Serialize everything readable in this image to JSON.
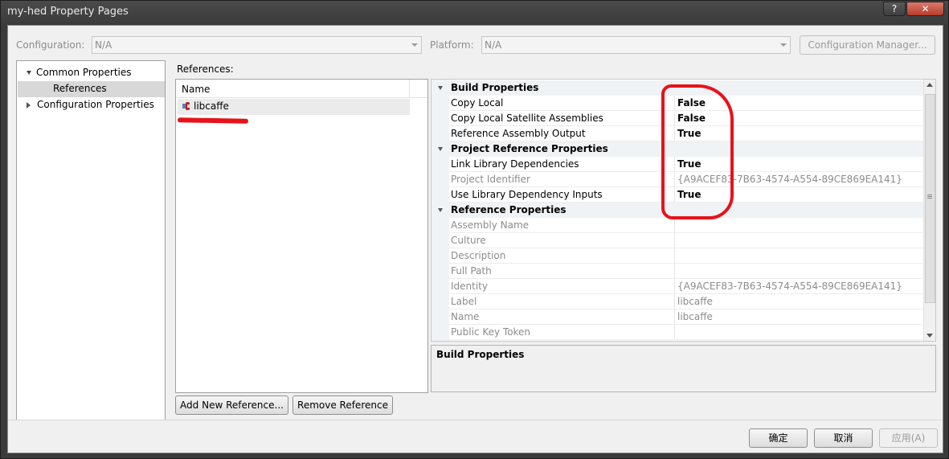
{
  "window": {
    "title": "my-hed Property Pages",
    "help_label": "?",
    "close_label": "✕"
  },
  "config": {
    "label": "Configuration:",
    "value": "N/A",
    "platform_label": "Platform:",
    "platform_value": "N/A",
    "manager_label": "Configuration Manager..."
  },
  "tree": {
    "items": [
      {
        "label": "Common Properties",
        "state": "expanded"
      },
      {
        "label": "References",
        "state": "selected"
      },
      {
        "label": "Configuration Properties",
        "state": "collapsed"
      }
    ]
  },
  "references": {
    "label": "References:",
    "column_name": "Name",
    "items": [
      {
        "name": "libcaffe",
        "icon": "reference-icon"
      }
    ],
    "add_label": "Add New Reference...",
    "remove_label": "Remove Reference"
  },
  "property_grid": {
    "categories": [
      {
        "name": "Build Properties",
        "rows": [
          {
            "name": "Copy Local",
            "value": "False",
            "bold": true
          },
          {
            "name": "Copy Local Satellite Assemblies",
            "value": "False",
            "bold": true
          },
          {
            "name": "Reference Assembly Output",
            "value": "True",
            "bold": true
          }
        ]
      },
      {
        "name": "Project Reference Properties",
        "rows": [
          {
            "name": "Link Library Dependencies",
            "value": "True",
            "bold": true
          },
          {
            "name": "Project Identifier",
            "value": "{A9ACEF83-7B63-4574-A554-89CE869EA141}",
            "disabled": true
          },
          {
            "name": "Use Library Dependency Inputs",
            "value": "True",
            "bold": true
          }
        ]
      },
      {
        "name": "Reference Properties",
        "rows": [
          {
            "name": "Assembly Name",
            "value": "",
            "disabled": true
          },
          {
            "name": "Culture",
            "value": "",
            "disabled": true
          },
          {
            "name": "Description",
            "value": "",
            "disabled": true
          },
          {
            "name": "Full Path",
            "value": "",
            "disabled": true
          },
          {
            "name": "Identity",
            "value": "{A9ACEF83-7B63-4574-A554-89CE869EA141}",
            "disabled": true
          },
          {
            "name": "Label",
            "value": "libcaffe",
            "disabled": true
          },
          {
            "name": "Name",
            "value": "libcaffe",
            "disabled": true
          },
          {
            "name": "Public Key Token",
            "value": "",
            "disabled": true
          }
        ]
      }
    ]
  },
  "description_panel": {
    "title": "Build Properties"
  },
  "footer": {
    "ok_label": "确定",
    "cancel_label": "取消",
    "apply_label": "应用(A)"
  },
  "colors": {
    "annotation": "#e8121a"
  }
}
